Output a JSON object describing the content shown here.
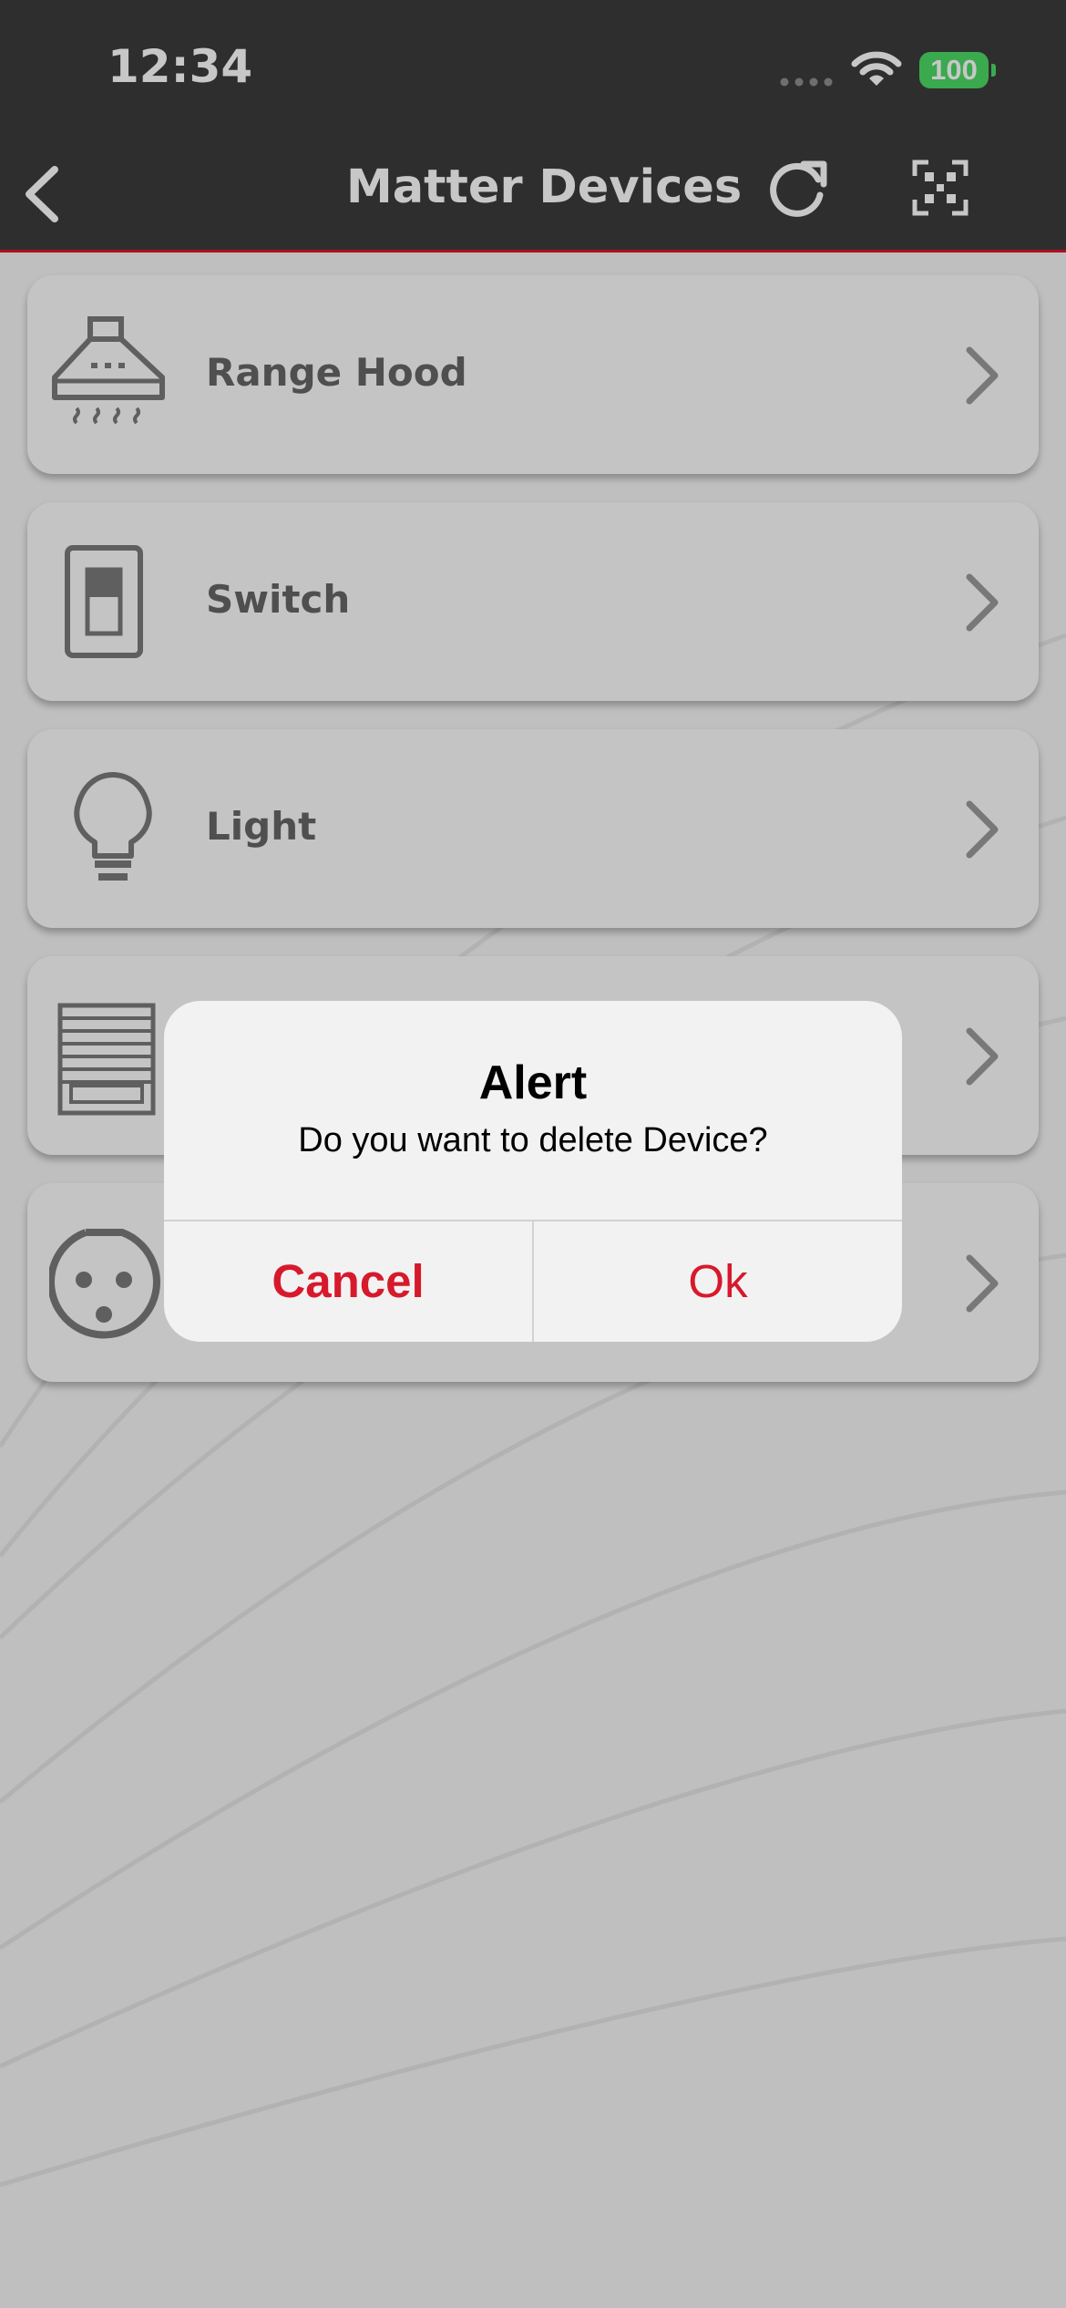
{
  "status_bar": {
    "time": "12:34",
    "battery": "100",
    "battery_color": "#4cd964"
  },
  "nav": {
    "title": "Matter Devices",
    "back_icon": "chevron-left-icon",
    "refresh_icon": "refresh-icon",
    "scan_icon": "qr-scan-icon",
    "accent_color": "#e0142a"
  },
  "devices": [
    {
      "label": "Range Hood",
      "icon": "range-hood-icon"
    },
    {
      "label": "Switch",
      "icon": "switch-icon"
    },
    {
      "label": "Light",
      "icon": "light-bulb-icon"
    },
    {
      "label": "",
      "icon": "window-blind-icon"
    },
    {
      "label": "",
      "icon": "outlet-icon"
    }
  ],
  "alert": {
    "title": "Alert",
    "message": "Do you want to delete Device?",
    "cancel_label": "Cancel",
    "ok_label": "Ok",
    "button_color": "#d7192c"
  }
}
